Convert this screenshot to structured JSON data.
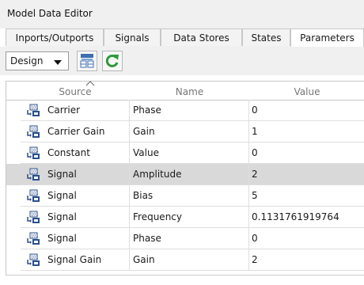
{
  "window": {
    "title": "Model Data Editor"
  },
  "tabs": [
    {
      "label": "Inports/Outports",
      "active": false
    },
    {
      "label": "Signals",
      "active": false
    },
    {
      "label": "Data Stores",
      "active": false
    },
    {
      "label": "States",
      "active": false
    },
    {
      "label": "Parameters",
      "active": true
    }
  ],
  "toolbar": {
    "view_selected": "Design",
    "buttons": [
      {
        "icon": "grid-layout-icon"
      },
      {
        "icon": "refresh-icon"
      }
    ]
  },
  "table": {
    "columns": [
      "Source",
      "Name",
      "Value"
    ],
    "sort_column": "Source",
    "rows": [
      {
        "source": "Carrier",
        "name": "Phase",
        "value": "0",
        "selected": false
      },
      {
        "source": "Carrier Gain",
        "name": "Gain",
        "value": "1",
        "selected": false
      },
      {
        "source": "Constant",
        "name": "Value",
        "value": "0",
        "selected": false
      },
      {
        "source": "Signal",
        "name": "Amplitude",
        "value": "2",
        "selected": true
      },
      {
        "source": "Signal",
        "name": "Bias",
        "value": "5",
        "selected": false
      },
      {
        "source": "Signal",
        "name": "Frequency",
        "value": "0.1131761919764",
        "selected": false
      },
      {
        "source": "Signal",
        "name": "Phase",
        "value": "0",
        "selected": false
      },
      {
        "source": "Signal Gain",
        "name": "Gain",
        "value": "2",
        "selected": false
      }
    ]
  },
  "colors": {
    "selected_row": "#d9d9d9",
    "accent_green": "#2e9a3a",
    "block_icon_blue": "#2a4f8a"
  }
}
